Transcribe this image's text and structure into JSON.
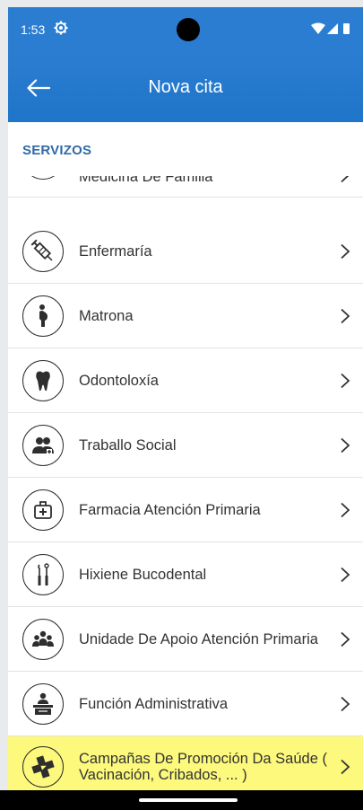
{
  "status_bar": {
    "time": "1:53",
    "settings_icon": "gear-icon",
    "icons": [
      "wifi-icon",
      "signal-icon",
      "battery-icon"
    ]
  },
  "app_bar": {
    "back_icon": "arrow-left-icon",
    "title": "Nova cita"
  },
  "section": {
    "title": "SERVIZOS"
  },
  "services": [
    {
      "label": "Medicina De Familia",
      "icon": "stethoscope-icon"
    },
    {
      "label": "Enfermaría",
      "icon": "syringe-icon"
    },
    {
      "label": "Matrona",
      "icon": "pregnant-woman-icon"
    },
    {
      "label": "Odontoloxía",
      "icon": "tooth-icon"
    },
    {
      "label": "Traballo Social",
      "icon": "social-workers-icon"
    },
    {
      "label": "Farmacia Atención Primaria",
      "icon": "first-aid-kit-icon"
    },
    {
      "label": "Hixiene Bucodental",
      "icon": "dental-tools-icon"
    },
    {
      "label": "Unidade De Apoio Atención Primaria",
      "icon": "group-icon"
    },
    {
      "label": "Función Administrativa",
      "icon": "desk-person-icon"
    },
    {
      "label": "Campañas De Promoción Da Saúde ( Vacinación, Cribados, ... )",
      "icon": "health-cross-icon"
    }
  ],
  "colors": {
    "app_bar": "#2b7dd1",
    "section_title": "#2f6aa9",
    "highlight": "#fcf97c"
  }
}
